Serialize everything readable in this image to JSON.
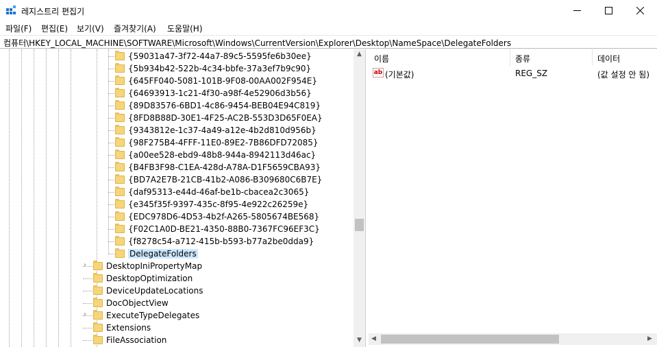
{
  "window": {
    "title": "레지스트리 편집기"
  },
  "menu": [
    "파일(F)",
    "편집(E)",
    "보기(V)",
    "즐겨찾기(A)",
    "도움말(H)"
  ],
  "address": "컴퓨터\\HKEY_LOCAL_MACHINE\\SOFTWARE\\Microsoft\\Windows\\CurrentVersion\\Explorer\\Desktop\\NameSpace\\DelegateFolders",
  "tree": {
    "guid_items": [
      "{59031a47-3f72-44a7-89c5-5595fe6b30ee}",
      "{5b934b42-522b-4c34-bbfe-37a3ef7b9c90}",
      "{645FF040-5081-101B-9F08-00AA002F954E}",
      "{64693913-1c21-4f30-a98f-4e52906d3b56}",
      "{89D83576-6BD1-4c86-9454-BEB04E94C819}",
      "{8FD8B88D-30E1-4F25-AC2B-553D3D65F0EA}",
      "{9343812e-1c37-4a49-a12e-4b2d810d956b}",
      "{98F275B4-4FFF-11E0-89E2-7B86DFD72085}",
      "{a00ee528-ebd9-48b8-944a-8942113d46ac}",
      "{B4FB3F98-C1EA-428d-A78A-D1F5659CBA93}",
      "{BD7A2E7B-21CB-41b2-A086-B309680C6B7E}",
      "{daf95313-e44d-46af-be1b-cbacea2c3065}",
      "{e345f35f-9397-435c-8f95-4e922c26259e}",
      "{EDC978D6-4D53-4b2f-A265-5805674BE568}",
      "{F02C1A0D-BE21-4350-88B0-7367FC96EF3C}",
      "{f8278c54-a712-415b-b593-b77a2be0dda9}"
    ],
    "selected": "DelegateFolders",
    "siblings": [
      {
        "label": "DesktopIniPropertyMap",
        "expandable": true
      },
      {
        "label": "DesktopOptimization",
        "expandable": false
      },
      {
        "label": "DeviceUpdateLocations",
        "expandable": false
      },
      {
        "label": "DocObjectView",
        "expandable": false
      },
      {
        "label": "ExecuteTypeDelegates",
        "expandable": true
      },
      {
        "label": "Extensions",
        "expandable": false
      },
      {
        "label": "FileAssociation",
        "expandable": false
      }
    ]
  },
  "values_pane": {
    "headers": {
      "name": "이름",
      "type": "종류",
      "data": "데이터"
    },
    "rows": [
      {
        "name": "(기본값)",
        "type": "REG_SZ",
        "data": "(값 설정 안 됨)",
        "icon": "ab"
      }
    ]
  },
  "colors": {
    "selection": "#cce8ff",
    "folder": "#f6d57b",
    "scroll_thumb": "#c2c2c2"
  }
}
